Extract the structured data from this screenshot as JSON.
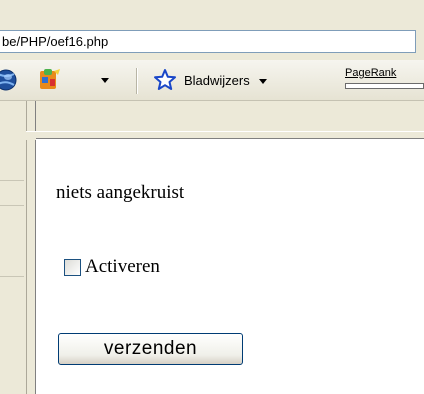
{
  "address_bar": {
    "url": "be/PHP/oef16.php"
  },
  "toolbar": {
    "bookmarks_label": "Bladwijzers",
    "pagerank_label": "PageRank",
    "icons": [
      "globe-icon",
      "puzzle-icon",
      "star-icon"
    ]
  },
  "page": {
    "status_text": "niets aangekruist",
    "checkbox_label": "Activeren",
    "checkbox_checked": false,
    "submit_label": "verzenden"
  }
}
